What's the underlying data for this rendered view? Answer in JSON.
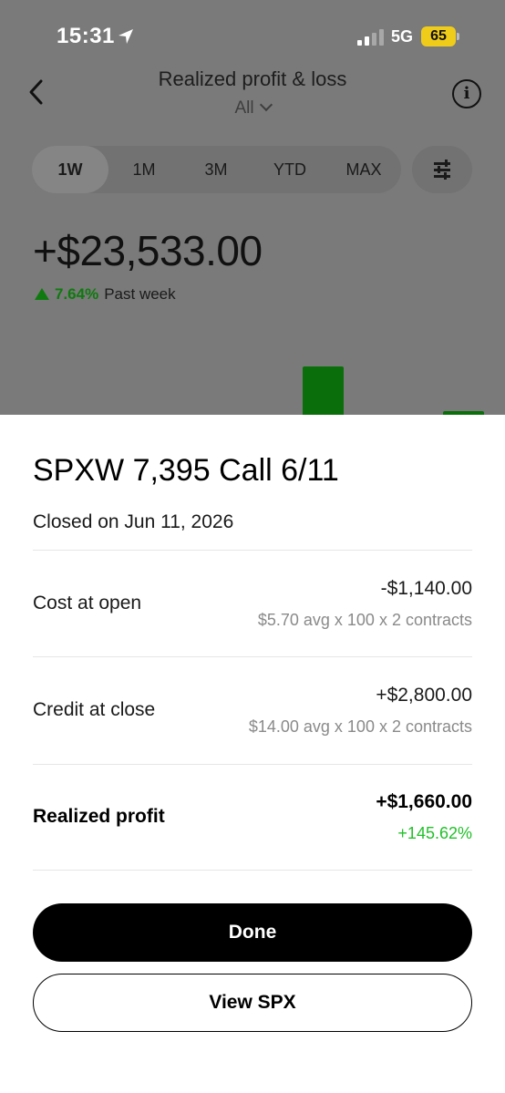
{
  "status_bar": {
    "time": "15:31",
    "network": "5G",
    "battery": "65"
  },
  "nav": {
    "title": "Realized profit & loss",
    "filter": "All"
  },
  "periods": [
    "1W",
    "1M",
    "3M",
    "YTD",
    "MAX"
  ],
  "active_period": "1W",
  "summary": {
    "value": "+$23,533.00",
    "change_pct": "7.64%",
    "period_label": "Past week"
  },
  "sheet": {
    "title": "SPXW 7,395 Call 6/11",
    "closed_on": "Closed on Jun 11, 2026",
    "rows": [
      {
        "label": "Cost at open",
        "value": "-$1,140.00",
        "detail": "$5.70 avg x 100 x 2 contracts"
      },
      {
        "label": "Credit at close",
        "value": "+$2,800.00",
        "detail": "$14.00 avg x 100 x 2 contracts"
      },
      {
        "label": "Realized profit",
        "value": "+$1,660.00",
        "detail": "+145.62%"
      }
    ],
    "done_label": "Done",
    "view_label": "View SPX"
  },
  "colors": {
    "gain_green": "#22c02a",
    "battery_yellow": "#f0cc1a"
  }
}
